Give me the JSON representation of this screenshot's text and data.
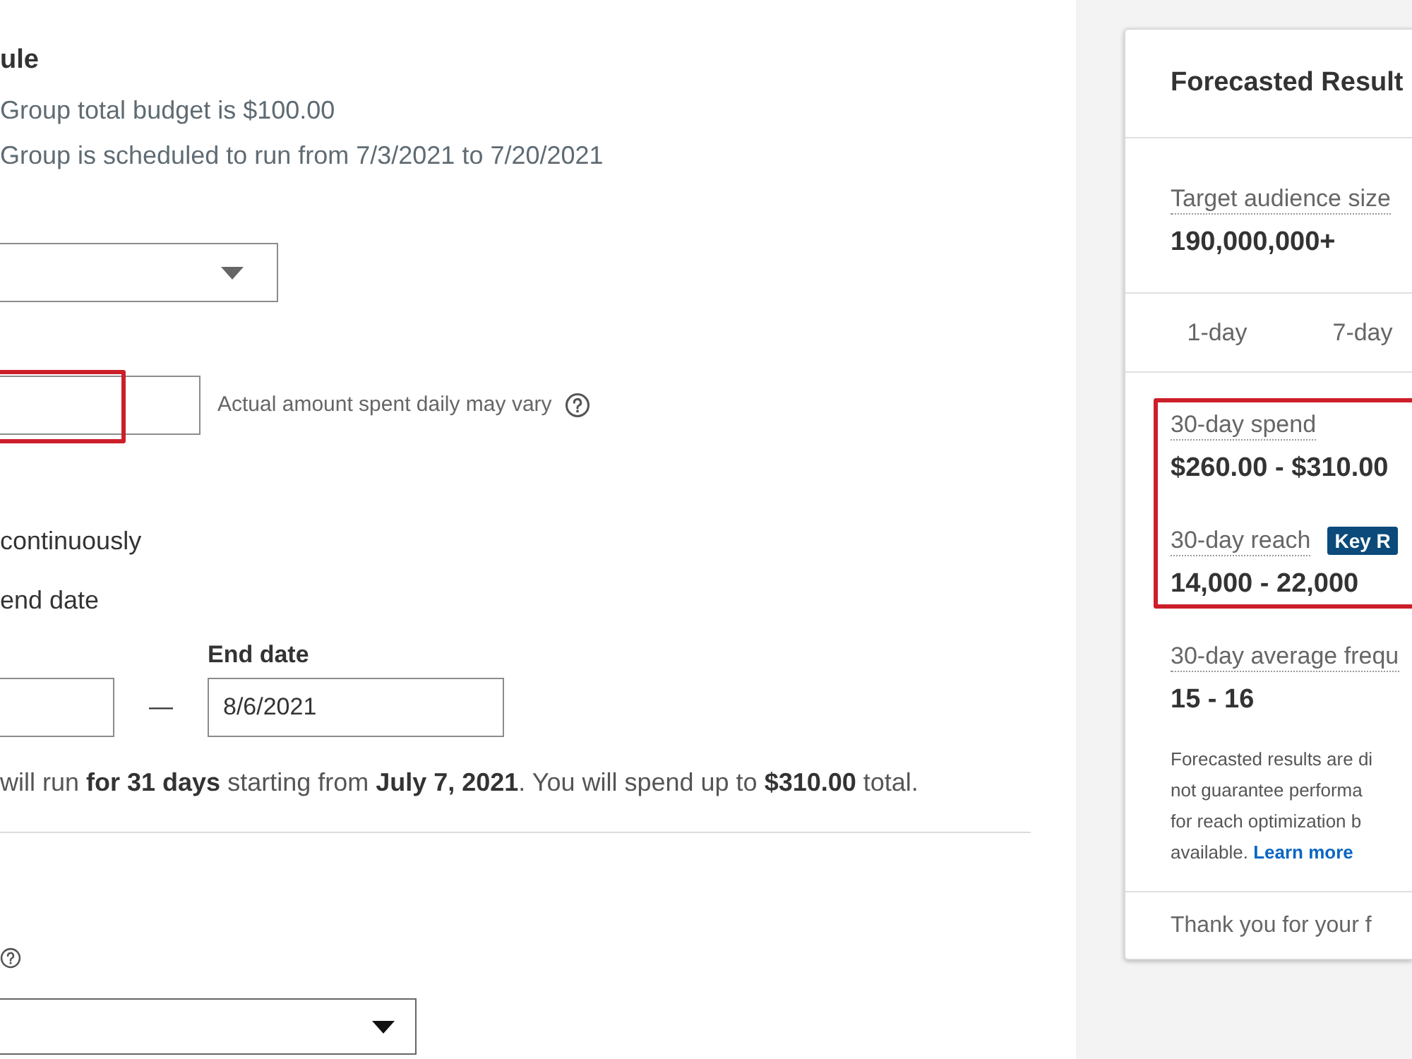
{
  "form": {
    "section_title": "ule",
    "summary_lines": [
      "Group total budget is $100.00",
      "Group is scheduled to run from 7/3/2021 to 7/20/2021"
    ],
    "daily_budget": {
      "highlighted": true,
      "note": "Actual amount spent daily may vary"
    },
    "schedule_options": [
      {
        "label": "continuously"
      },
      {
        "label": "end date"
      }
    ],
    "end_date": {
      "label": "End date",
      "value": "8/6/2021"
    },
    "date_separator": "—",
    "schedule_summary": "will run **for 31 days** starting from **July 7, 2021**. You will spend up to **$310.00** total."
  },
  "forecast": {
    "title": "Forecasted Result",
    "audience": {
      "label": "Target audience size",
      "value": "190,000,000+"
    },
    "tabs": [
      {
        "label": "1-day",
        "selected": false
      },
      {
        "label": "7-day",
        "selected": false
      }
    ],
    "metrics": [
      {
        "label": "30-day spend",
        "value": "$260.00 - $310.00",
        "highlighted": true
      },
      {
        "label": "30-day reach",
        "badge": "Key R",
        "value": "14,000 - 22,000",
        "highlighted": true
      },
      {
        "label": "30-day average frequ",
        "value": "15 - 16"
      }
    ],
    "disclaimer": {
      "lines": [
        "Forecasted results are di",
        "not guarantee performa",
        "for reach optimization b",
        "available."
      ],
      "link": "Learn more"
    },
    "footer": "Thank you for your f"
  }
}
